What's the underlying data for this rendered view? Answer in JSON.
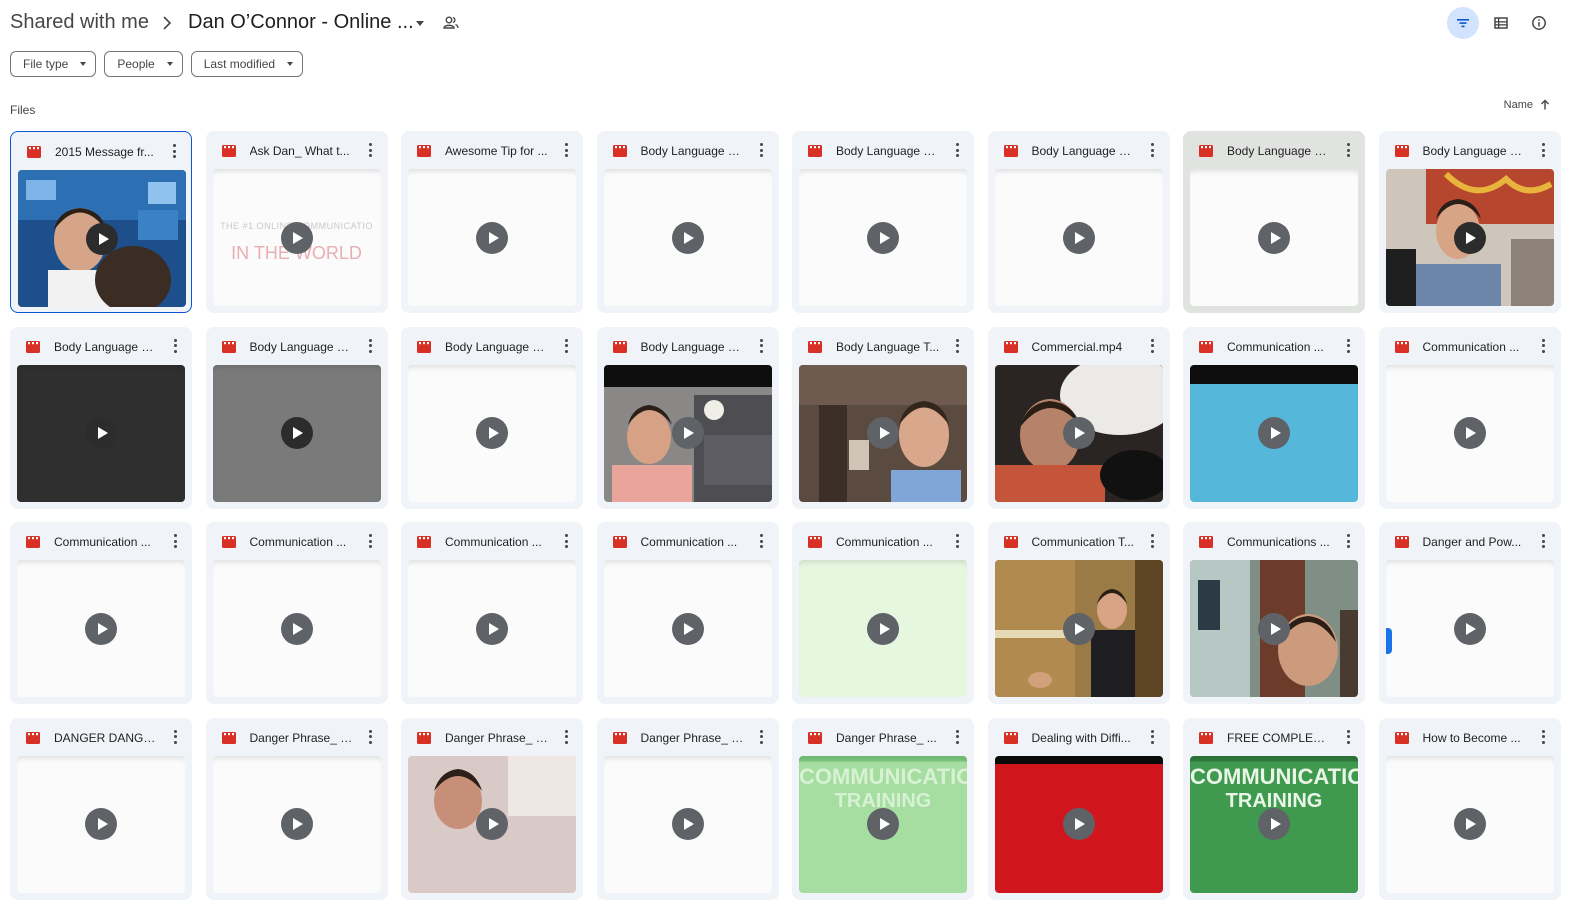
{
  "breadcrumb": {
    "root": "Shared with me",
    "current": "Dan O’Connor - Online ..."
  },
  "icons": {
    "separator": "chevron-right-icon",
    "caret": "caret-down-icon",
    "shared": "shared-folder-people-icon",
    "filter": "filter-list-icon",
    "list_view": "list-view-icon",
    "details": "info-icon",
    "sort_arrow": "arrow-up-icon",
    "file_type": "video-file-icon",
    "more": "more-vert-icon",
    "play": "play-circle-icon"
  },
  "toolbar": {
    "filter_active": true
  },
  "filters": [
    {
      "label": "File type"
    },
    {
      "label": "People"
    },
    {
      "label": "Last modified"
    }
  ],
  "files_section": {
    "label": "Files",
    "sort_label": "Name",
    "sort_direction": "ascending"
  },
  "colors": {
    "accent": "#0b57d0",
    "accent_light": "#d3e3fd",
    "video_icon": "#d93025",
    "card_bg": "#f0f4f9"
  },
  "files": [
    {
      "name": "2015 Message fr...",
      "thumb": "photo-blue",
      "state": "selected"
    },
    {
      "name": "Ask Dan_ What t...",
      "thumb": "title-card",
      "overlay_small": "THE #1 ONLINE COMMUNICATIO",
      "overlay_big": "IN THE WORLD"
    },
    {
      "name": "Awesome Tip for ...",
      "thumb": "blank"
    },
    {
      "name": "Body Language S...",
      "thumb": "blank"
    },
    {
      "name": "Body Language S...",
      "thumb": "blank"
    },
    {
      "name": "Body Language S...",
      "thumb": "blank"
    },
    {
      "name": "Body Language S...",
      "thumb": "blank",
      "state": "hovered"
    },
    {
      "name": "Body Language S...",
      "thumb": "photo-office"
    },
    {
      "name": "Body Language S...",
      "thumb": "dark"
    },
    {
      "name": "Body Language S...",
      "thumb": "gray"
    },
    {
      "name": "Body Language S...",
      "thumb": "blank"
    },
    {
      "name": "Body Language S...",
      "thumb": "photo-living"
    },
    {
      "name": "Body Language T...",
      "thumb": "photo-room"
    },
    {
      "name": "Commercial.mp4",
      "thumb": "photo-pillow"
    },
    {
      "name": "Communication ...",
      "thumb": "blue"
    },
    {
      "name": "Communication ...",
      "thumb": "blank"
    },
    {
      "name": "Communication ...",
      "thumb": "blank"
    },
    {
      "name": "Communication ...",
      "thumb": "blank"
    },
    {
      "name": "Communication ...",
      "thumb": "blank"
    },
    {
      "name": "Communication ...",
      "thumb": "blank"
    },
    {
      "name": "Communication ...",
      "thumb": "pale-green"
    },
    {
      "name": "Communication T...",
      "thumb": "photo-stage"
    },
    {
      "name": "Communications ...",
      "thumb": "photo-hall"
    },
    {
      "name": "Danger and Pow...",
      "thumb": "blank-mark"
    },
    {
      "name": "DANGER DANGE...",
      "thumb": "blank"
    },
    {
      "name": "Danger Phrase_ _...",
      "thumb": "blank"
    },
    {
      "name": "Danger Phrase_ _...",
      "thumb": "photo-pink"
    },
    {
      "name": "Danger Phrase_ _...",
      "thumb": "blank"
    },
    {
      "name": "Danger Phrase_ ...",
      "thumb": "green-title",
      "overlay_big": "COMMUNICATIO",
      "overlay_big2": "TRAINING"
    },
    {
      "name": "Dealing with Diffi...",
      "thumb": "red"
    },
    {
      "name": "FREE COMPLETE...",
      "thumb": "dark-green-title",
      "overlay_big": "COMMUNICATIO",
      "overlay_big2": "TRAINING"
    },
    {
      "name": "How to Become ...",
      "thumb": "blank"
    }
  ]
}
